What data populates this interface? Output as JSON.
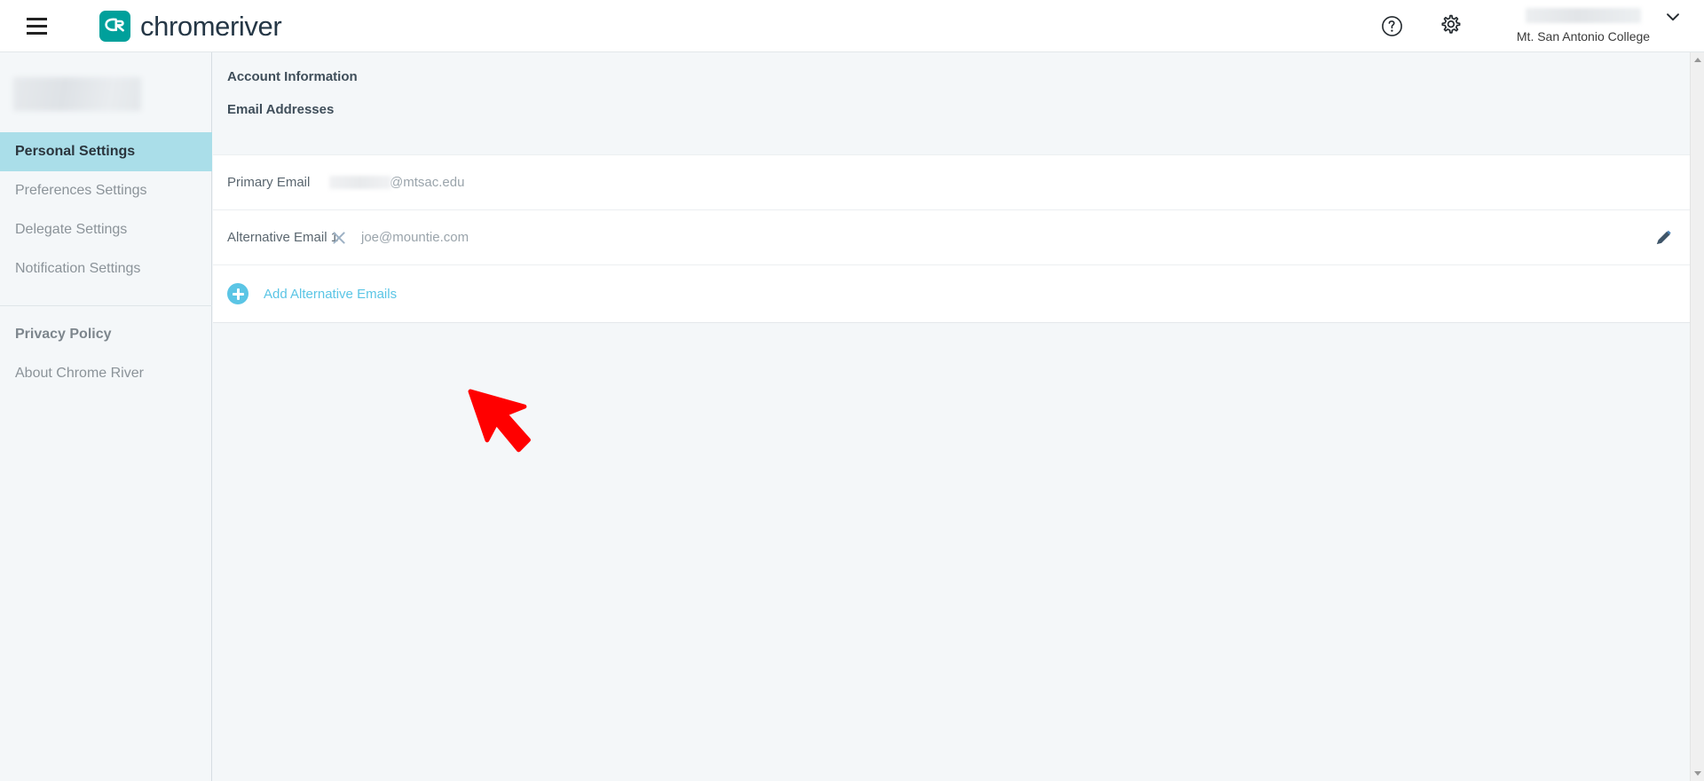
{
  "app": {
    "brand_name": "chromeriver",
    "brand_color": "#00a09b",
    "accent_color": "#5bc5e5",
    "active_nav_color": "#aadee9"
  },
  "topbar": {
    "menu_icon": "hamburger-icon",
    "help_icon": "help-circle-icon",
    "gear_icon": "gear-icon",
    "caret_icon": "chevron-down-icon",
    "user_name": "",
    "user_org": "Mt. San Antonio College"
  },
  "sidebar": {
    "user_name": "",
    "primary_items": [
      {
        "label": "Personal Settings",
        "active": true
      },
      {
        "label": "Preferences Settings",
        "active": false
      },
      {
        "label": "Delegate Settings",
        "active": false
      },
      {
        "label": "Notification Settings",
        "active": false
      }
    ],
    "secondary_items": [
      {
        "label": "Privacy Policy",
        "strong": true
      },
      {
        "label": "About Chrome River",
        "strong": false
      }
    ]
  },
  "main": {
    "section_title": "Account Information",
    "subsection_title": "Email Addresses",
    "rows": [
      {
        "label": "Primary Email",
        "value": "@mtsac.edu",
        "redacted": true,
        "removable": false,
        "editable": false
      },
      {
        "label": "Alternative Email 1",
        "value": "joe@mountie.com",
        "redacted": false,
        "removable": true,
        "editable": true,
        "remove_icon": "close-x-icon",
        "edit_icon": "pencil-icon"
      }
    ],
    "add_button": {
      "label": "Add Alternative Emails",
      "icon": "plus-circle-icon"
    }
  },
  "annotation": {
    "cursor": "red-arrow-cursor",
    "color": "#ff0000"
  },
  "scrollbar": {
    "up_icon": "scroll-up-arrow",
    "down_icon": "scroll-down-arrow"
  }
}
